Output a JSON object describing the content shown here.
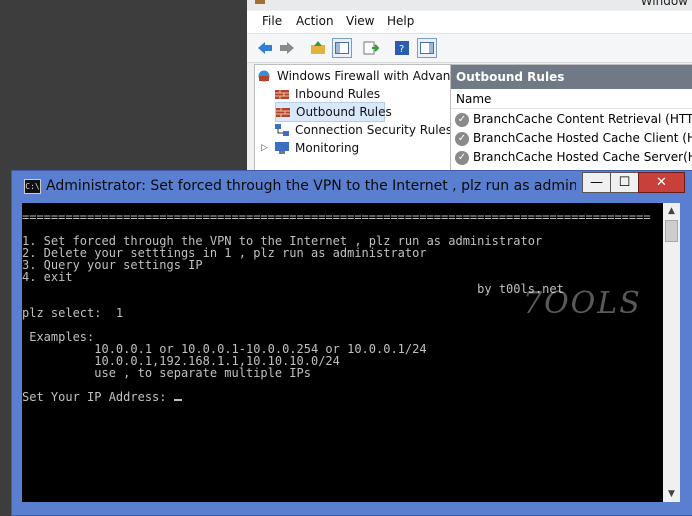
{
  "mmc": {
    "window_title": "Window",
    "menu": [
      "File",
      "Action",
      "View",
      "Help"
    ],
    "tree": {
      "root": "Windows Firewall with Advance",
      "items": [
        "Inbound Rules",
        "Outbound Rules",
        "Connection Security Rules",
        "Monitoring"
      ]
    },
    "right_pane": {
      "header": "Outbound Rules",
      "column_name": "Name",
      "rules": [
        "BranchCache Content Retrieval (HTTP-O...",
        "BranchCache Hosted Cache Client (HTT...",
        "BranchCache Hosted Cache Server(HTTP..."
      ]
    }
  },
  "console": {
    "title": "Administrator:  Set forced through the VPN to the Internet , plz run as administr...",
    "cmd_icon": "C:\\",
    "lines": [
      "=======================================================================================",
      "",
      "1. Set forced through the VPN to the Internet , plz run as administrator",
      "2. Delete your setttings in 1 , plz run as administrator",
      "3. Query your settings IP",
      "4. exit",
      "                                                               by t00ls.net",
      "",
      "plz select:  1",
      "",
      " Examples:",
      "          10.0.0.1 or 10.0.0.1-10.0.0.254 or 10.0.0.1/24",
      "          10.0.0.1,192.168.1.1,10.10.10.0/24",
      "          use , to separate multiple IPs",
      "",
      "Set Your IP Address: "
    ],
    "buttons": {
      "minimize": "—",
      "maximize": "☐",
      "close": "✕"
    }
  },
  "watermark": "7OOLS",
  "colors": {
    "console_frame": "#5a7fd1",
    "close_button": "#c9403a",
    "pane_header": "#707a86",
    "selection": "#d9e8fb"
  }
}
